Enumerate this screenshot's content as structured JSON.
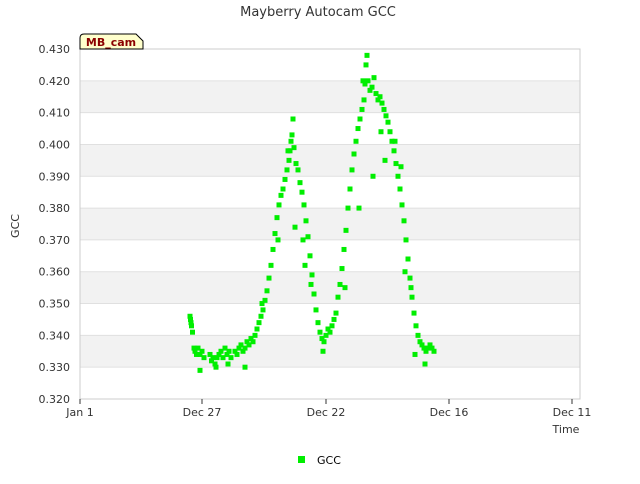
{
  "chart_data": {
    "type": "scatter",
    "title": "Mayberry Autocam GCC",
    "xlabel": "Time",
    "ylabel": "GCC",
    "ylim": [
      0.32,
      0.43
    ],
    "y_ticks": [
      "0.320",
      "0.330",
      "0.340",
      "0.350",
      "0.360",
      "0.370",
      "0.380",
      "0.390",
      "0.400",
      "0.410",
      "0.420",
      "0.430"
    ],
    "x_ticks": [
      {
        "label": "Jan 1",
        "t": 0
      },
      {
        "label": "Dec 27",
        "t": 24.4
      },
      {
        "label": "Dec 22",
        "t": 49.2
      },
      {
        "label": "Dec 16",
        "t": 73.8
      },
      {
        "label": "Dec 11",
        "t": 98.4
      }
    ],
    "x_range": [
      0,
      100
    ],
    "grid": "horizontal alternating bands",
    "legend_position": "bottom-center",
    "badge": "MB_cam",
    "series": [
      {
        "name": "GCC",
        "color": "#00ee00",
        "points": [
          [
            22.0,
            0.346
          ],
          [
            22.1,
            0.345
          ],
          [
            22.2,
            0.344
          ],
          [
            22.3,
            0.343
          ],
          [
            22.5,
            0.341
          ],
          [
            22.8,
            0.336
          ],
          [
            23.0,
            0.335
          ],
          [
            23.3,
            0.334
          ],
          [
            23.6,
            0.336
          ],
          [
            24.0,
            0.334
          ],
          [
            24.4,
            0.335
          ],
          [
            24.8,
            0.333
          ],
          [
            26.0,
            0.334
          ],
          [
            26.3,
            0.332
          ],
          [
            26.6,
            0.333
          ],
          [
            27.0,
            0.331
          ],
          [
            27.4,
            0.333
          ],
          [
            27.8,
            0.334
          ],
          [
            28.2,
            0.335
          ],
          [
            28.6,
            0.333
          ],
          [
            29.0,
            0.336
          ],
          [
            29.4,
            0.334
          ],
          [
            29.8,
            0.335
          ],
          [
            30.2,
            0.333
          ],
          [
            31.0,
            0.335
          ],
          [
            31.4,
            0.334
          ],
          [
            31.8,
            0.336
          ],
          [
            32.2,
            0.337
          ],
          [
            32.6,
            0.335
          ],
          [
            33.0,
            0.336
          ],
          [
            33.4,
            0.338
          ],
          [
            33.8,
            0.337
          ],
          [
            34.2,
            0.339
          ],
          [
            34.6,
            0.338
          ],
          [
            35.0,
            0.34
          ],
          [
            35.4,
            0.342
          ],
          [
            35.8,
            0.344
          ],
          [
            36.2,
            0.346
          ],
          [
            36.6,
            0.348
          ],
          [
            37.0,
            0.351
          ],
          [
            37.4,
            0.354
          ],
          [
            37.8,
            0.358
          ],
          [
            38.2,
            0.362
          ],
          [
            38.6,
            0.367
          ],
          [
            39.0,
            0.372
          ],
          [
            39.4,
            0.377
          ],
          [
            39.8,
            0.381
          ],
          [
            40.2,
            0.384
          ],
          [
            40.6,
            0.386
          ],
          [
            41.0,
            0.389
          ],
          [
            41.4,
            0.392
          ],
          [
            41.8,
            0.395
          ],
          [
            42.0,
            0.398
          ],
          [
            42.2,
            0.401
          ],
          [
            42.4,
            0.403
          ],
          [
            42.6,
            0.408
          ],
          [
            42.8,
            0.399
          ],
          [
            43.2,
            0.394
          ],
          [
            43.6,
            0.392
          ],
          [
            44.0,
            0.388
          ],
          [
            44.4,
            0.385
          ],
          [
            44.8,
            0.381
          ],
          [
            45.2,
            0.376
          ],
          [
            45.6,
            0.371
          ],
          [
            46.0,
            0.365
          ],
          [
            46.4,
            0.359
          ],
          [
            46.8,
            0.353
          ],
          [
            47.2,
            0.348
          ],
          [
            47.6,
            0.344
          ],
          [
            48.0,
            0.341
          ],
          [
            48.4,
            0.339
          ],
          [
            48.8,
            0.338
          ],
          [
            49.2,
            0.34
          ],
          [
            49.6,
            0.342
          ],
          [
            50.0,
            0.341
          ],
          [
            50.4,
            0.343
          ],
          [
            50.8,
            0.345
          ],
          [
            51.2,
            0.347
          ],
          [
            51.6,
            0.352
          ],
          [
            52.0,
            0.356
          ],
          [
            52.4,
            0.361
          ],
          [
            52.8,
            0.367
          ],
          [
            53.2,
            0.373
          ],
          [
            53.6,
            0.38
          ],
          [
            54.0,
            0.386
          ],
          [
            54.4,
            0.392
          ],
          [
            54.8,
            0.397
          ],
          [
            55.2,
            0.401
          ],
          [
            55.6,
            0.405
          ],
          [
            56.0,
            0.408
          ],
          [
            56.4,
            0.411
          ],
          [
            56.8,
            0.414
          ],
          [
            57.0,
            0.419
          ],
          [
            57.2,
            0.425
          ],
          [
            57.4,
            0.428
          ],
          [
            57.6,
            0.42
          ],
          [
            58.0,
            0.417
          ],
          [
            58.4,
            0.418
          ],
          [
            58.8,
            0.421
          ],
          [
            59.2,
            0.416
          ],
          [
            59.6,
            0.414
          ],
          [
            60.0,
            0.415
          ],
          [
            60.4,
            0.413
          ],
          [
            60.8,
            0.411
          ],
          [
            61.2,
            0.409
          ],
          [
            61.6,
            0.407
          ],
          [
            62.0,
            0.404
          ],
          [
            62.4,
            0.401
          ],
          [
            62.8,
            0.398
          ],
          [
            63.2,
            0.394
          ],
          [
            63.6,
            0.39
          ],
          [
            64.0,
            0.386
          ],
          [
            64.4,
            0.381
          ],
          [
            64.8,
            0.376
          ],
          [
            65.2,
            0.37
          ],
          [
            65.6,
            0.364
          ],
          [
            66.0,
            0.358
          ],
          [
            66.4,
            0.352
          ],
          [
            66.8,
            0.347
          ],
          [
            67.2,
            0.343
          ],
          [
            67.6,
            0.34
          ],
          [
            68.0,
            0.338
          ],
          [
            68.4,
            0.337
          ],
          [
            68.8,
            0.336
          ],
          [
            69.2,
            0.335
          ],
          [
            69.6,
            0.336
          ],
          [
            70.0,
            0.337
          ],
          [
            70.4,
            0.336
          ],
          [
            70.8,
            0.335
          ],
          [
            33.0,
            0.33
          ],
          [
            55.8,
            0.38
          ],
          [
            58.6,
            0.39
          ],
          [
            61.0,
            0.395
          ],
          [
            63.0,
            0.401
          ],
          [
            64.2,
            0.393
          ],
          [
            65.0,
            0.36
          ],
          [
            66.2,
            0.355
          ],
          [
            43.0,
            0.374
          ],
          [
            44.6,
            0.37
          ],
          [
            45.0,
            0.362
          ],
          [
            39.6,
            0.37
          ],
          [
            24.0,
            0.329
          ],
          [
            27.2,
            0.33
          ],
          [
            29.6,
            0.331
          ],
          [
            48.6,
            0.335
          ],
          [
            67.0,
            0.334
          ],
          [
            69.0,
            0.331
          ],
          [
            36.4,
            0.35
          ],
          [
            53.0,
            0.355
          ],
          [
            56.6,
            0.42
          ],
          [
            60.2,
            0.404
          ],
          [
            41.6,
            0.398
          ],
          [
            46.2,
            0.356
          ]
        ]
      }
    ]
  }
}
